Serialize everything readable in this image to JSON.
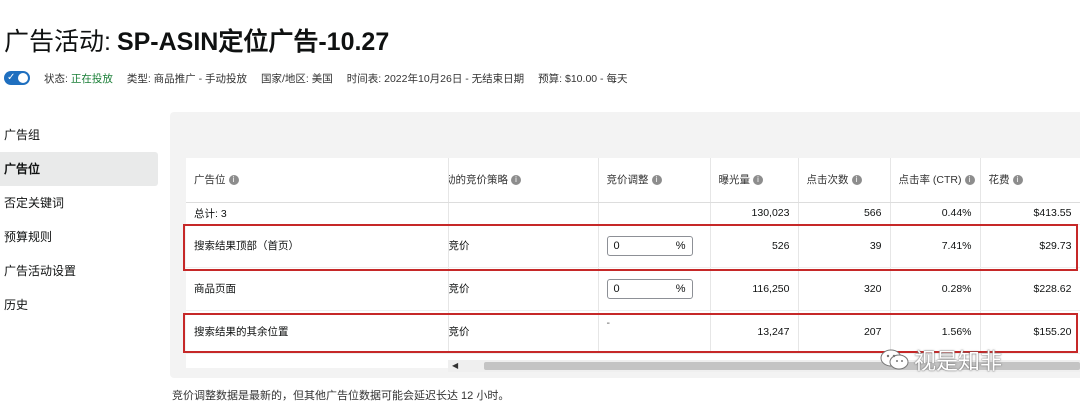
{
  "header": {
    "title_prefix": "广告活动:",
    "campaign_name": "SP-ASIN定位广告-10.27"
  },
  "meta": {
    "status_label": "状态:",
    "status_value": "正在投放",
    "type": "类型: 商品推广 - 手动投放",
    "country": "国家/地区: 美国",
    "schedule": "时间表: 2022年10月26日 - 无结束日期",
    "budget": "预算: $10.00 - 每天"
  },
  "sidebar": {
    "items": [
      {
        "label": "广告组"
      },
      {
        "label": "广告位"
      },
      {
        "label": "否定关键词"
      },
      {
        "label": "预算规则"
      },
      {
        "label": "广告活动设置"
      },
      {
        "label": "历史"
      }
    ]
  },
  "table": {
    "headers": [
      "广告位",
      "活动的竞价策略",
      "竞价调整",
      "曝光量",
      "点击次数",
      "点击率 (CTR)",
      "花费"
    ],
    "total": {
      "label": "总计: 3",
      "impressions": "130,023",
      "clicks": "566",
      "ctr": "0.44%",
      "spend": "$413.55"
    },
    "rows": [
      {
        "placement": "搜索结果顶部（首页）",
        "strategy": "竞价",
        "bid_value": "0",
        "bid_unit": "%",
        "impressions": "526",
        "clicks": "39",
        "ctr": "7.41%",
        "spend": "$29.73"
      },
      {
        "placement": "商品页面",
        "strategy": "竞价",
        "bid_value": "0",
        "bid_unit": "%",
        "impressions": "116,250",
        "clicks": "320",
        "ctr": "0.28%",
        "spend": "$228.62"
      },
      {
        "placement": "搜索结果的其余位置",
        "strategy": "竞价",
        "bid_value": "-",
        "impressions": "13,247",
        "clicks": "207",
        "ctr": "1.56%",
        "spend": "$155.20"
      }
    ]
  },
  "footnote": "竞价调整数据是最新的，但其他广告位数据可能会延迟长达 12 小时。",
  "watermark": "视是知非",
  "colors": {
    "toggle": "#1f6fbf",
    "status": "#1a7f37",
    "highlight": "#c62828"
  }
}
